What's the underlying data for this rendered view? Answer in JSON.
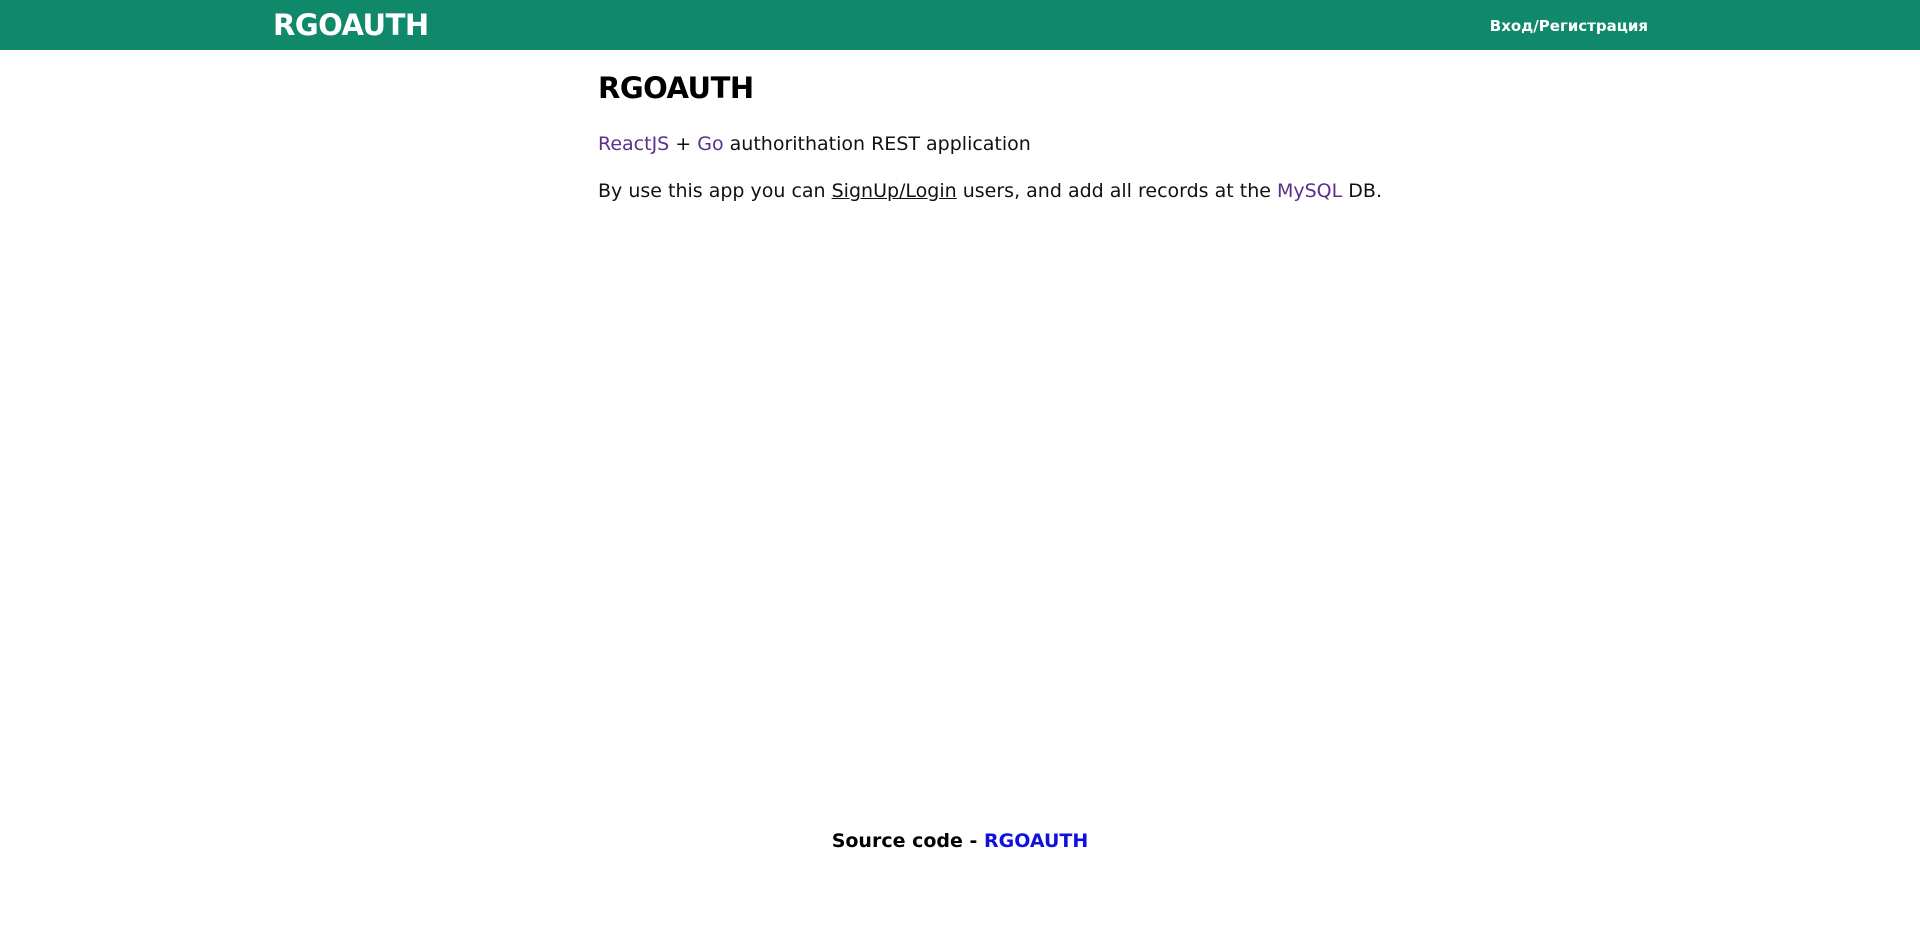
{
  "header": {
    "brand": "RGOAUTH",
    "login_link": "Вход/Регистрация",
    "background_color": "#10896a"
  },
  "main": {
    "title": "RGOAUTH",
    "line1": {
      "link1": "ReactJS",
      "sep": " + ",
      "link2": "Go",
      "rest": " authorithation REST application"
    },
    "line2": {
      "before": "By use this app you can ",
      "link_signup": "SignUp/Login",
      "middle": " users, and add all records at the ",
      "link_db": "MySQL",
      "after": " DB."
    }
  },
  "footer": {
    "label": "Source code - ",
    "link": "RGOAUTH"
  }
}
